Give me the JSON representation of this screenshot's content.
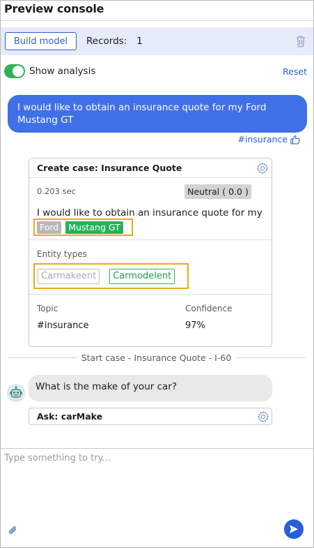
{
  "header": {
    "title": "Preview console"
  },
  "toolbar": {
    "build_label": "Build model",
    "records_label": "Records:",
    "records_count": "1"
  },
  "analysis": {
    "toggle_label": "Show analysis",
    "toggle_on": true,
    "reset_label": "Reset"
  },
  "user_message": {
    "text": "I would like to obtain an insurance quote for my Ford Mustang GT",
    "topic_tag": "#insurance"
  },
  "analysis_card": {
    "title": "Create case:  Insurance Quote",
    "time": "0.203 sec",
    "sentiment": "Neutral ( 0.0 )",
    "utterance": "I would like to obtain an insurance quote for my",
    "entities": [
      "Ford",
      "Mustang GT"
    ],
    "entity_types_label": "Entity types",
    "entity_types": [
      "Carmakeent",
      "Carmodelent"
    ],
    "topic_header": "Topic",
    "confidence_header": "Confidence",
    "topic_value": "#insurance",
    "confidence_value": "97%"
  },
  "separator": {
    "text": "Start case - Insurance Quote - I-60"
  },
  "bot_message": {
    "text": "What is the make of your car?"
  },
  "ask_card": {
    "label": "Ask:  carMake"
  },
  "composer": {
    "placeholder": "Type something to try..."
  },
  "colors": {
    "accent_blue": "#295ed9",
    "user_bubble": "#3f70e8",
    "toolbar_bg": "#e6ebfa",
    "toggle_green": "#2db358",
    "highlight_orange": "#f0a71a",
    "entity_green": "#24b35a"
  },
  "icons": [
    "trash-icon",
    "thumbs-up-icon",
    "gear-icon",
    "bot-avatar-icon",
    "paperclip-icon",
    "send-icon"
  ]
}
